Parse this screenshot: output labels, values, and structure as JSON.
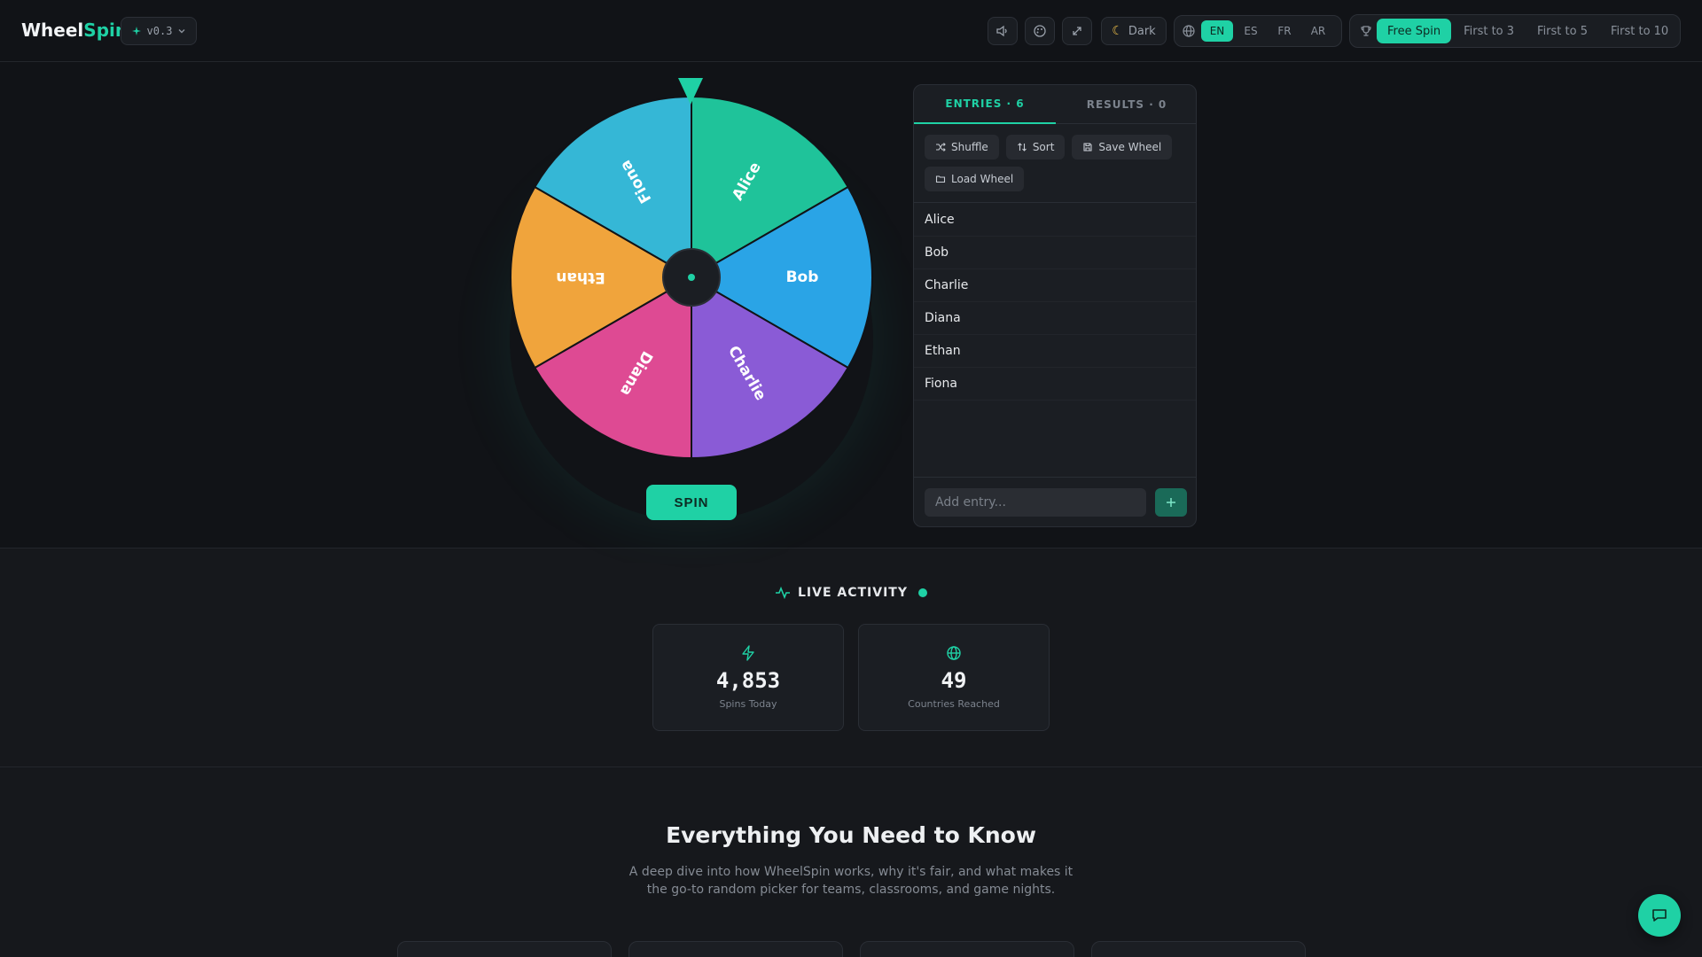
{
  "header": {
    "logo_primary": "Wheel",
    "logo_accent": "Spin",
    "version": "v0.3",
    "theme_label": "Dark",
    "languages": [
      "EN",
      "ES",
      "FR",
      "AR"
    ],
    "active_language": "EN",
    "modes": [
      "Free Spin",
      "First to 3",
      "First to 5",
      "First to 10"
    ],
    "active_mode": "Free Spin"
  },
  "wheel": {
    "segments": [
      {
        "label": "Alice",
        "color": "#1fc39a"
      },
      {
        "label": "Bob",
        "color": "#2aa4e6"
      },
      {
        "label": "Charlie",
        "color": "#8a5bd6"
      },
      {
        "label": "Diana",
        "color": "#de4a93"
      },
      {
        "label": "Ethan",
        "color": "#f0a43c"
      },
      {
        "label": "Fiona",
        "color": "#35b7d6"
      }
    ],
    "spin_label": "SPIN",
    "accent": "#1fd1a5"
  },
  "panel": {
    "tab_entries": "ENTRIES · 6",
    "tab_results": "RESULTS · 0",
    "tools": {
      "shuffle": "Shuffle",
      "sort": "Sort",
      "save": "Save Wheel",
      "load": "Load Wheel"
    },
    "entries": [
      "Alice",
      "Bob",
      "Charlie",
      "Diana",
      "Ethan",
      "Fiona"
    ],
    "add_placeholder": "Add entry..."
  },
  "live": {
    "title": "LIVE ACTIVITY",
    "stats": [
      {
        "value": "4,853",
        "label": "Spins Today",
        "icon": "zap-icon"
      },
      {
        "value": "49",
        "label": "Countries Reached",
        "icon": "globe-icon"
      }
    ]
  },
  "faq": {
    "title": "Everything You Need to Know",
    "subtitle": "A deep dive into how WheelSpin works, why it's fair, and what makes it the go-to random picker for teams, classrooms, and game nights."
  }
}
